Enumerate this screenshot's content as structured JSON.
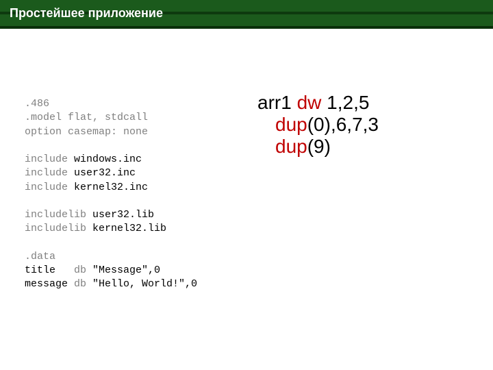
{
  "header": {
    "title": "Простейшее приложение"
  },
  "code": {
    "l1": ".486",
    "l2": ".model flat, stdcall",
    "l3": "option casemap: none",
    "l4_kw": "include",
    "l4_rest": " windows.inc",
    "l5_kw": "include",
    "l5_rest": " user32.inc",
    "l6_kw": "include",
    "l6_rest": " kernel32.inc",
    "l7_kw": "includelib",
    "l7_rest": " user32.lib",
    "l8_kw": "includelib",
    "l8_rest": " kernel32.lib",
    "l9": ".data",
    "l10a": "title   ",
    "l10b": "db",
    "l10c": " \"Message\",0",
    "l11a": "message ",
    "l11b": "db",
    "l11c": " \"Hello, World!\",0"
  },
  "right": {
    "a1": "arr1 ",
    "a2": "dw",
    "a3": " 1,2,5",
    "b1": "dup",
    "b2": "(0),6,7,3",
    "c1": "dup",
    "c2": "(9)"
  }
}
